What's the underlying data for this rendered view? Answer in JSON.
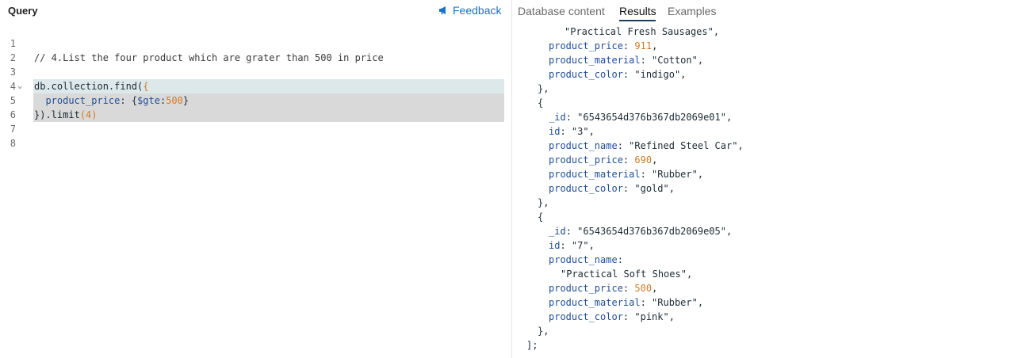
{
  "header": {
    "query_title": "Query",
    "feedback_label": "Feedback"
  },
  "tabs": [
    {
      "label": "Database content"
    },
    {
      "label": "Results"
    },
    {
      "label": "Examples"
    }
  ],
  "editor": {
    "line_numbers": [
      "1",
      "2",
      "3",
      "4",
      "5",
      "6",
      "7",
      "8"
    ],
    "comment": "// 4.List the four product which are grater than 500 in price",
    "l4_a": "db.collection.find(",
    "l4_b": "{",
    "l5_key": "product_price",
    "l5_colon": ": {",
    "l5_op": "$gte",
    "l5_sep": ":",
    "l5_num": "500",
    "l5_end": "}",
    "l6_a": "}",
    "l6_b": ").limit",
    "l6_c": "(4)"
  },
  "results": {
    "top_partial": "\"Practical Fresh Sausages\",",
    "records": [
      {
        "price": "911",
        "material": "\"Cotton\"",
        "color": "\"indigo\""
      },
      {
        "_id": "\"6543654d376b367db2069e01\"",
        "id": "\"3\"",
        "name": "\"Refined Steel Car\"",
        "price": "690",
        "material": "\"Rubber\"",
        "color": "\"gold\""
      },
      {
        "_id": "\"6543654d376b367db2069e05\"",
        "id": "\"7\"",
        "name": "\"Practical Soft Shoes\"",
        "price": "500",
        "material": "\"Rubber\"",
        "color": "\"pink\""
      }
    ],
    "keys": {
      "id_key": "_id",
      "idn_key": "id",
      "name_key": "product_name",
      "price_key": "product_price",
      "material_key": "product_material",
      "color_key": "product_color"
    },
    "open_brace": "{",
    "close_brace": "},",
    "end": "];"
  }
}
